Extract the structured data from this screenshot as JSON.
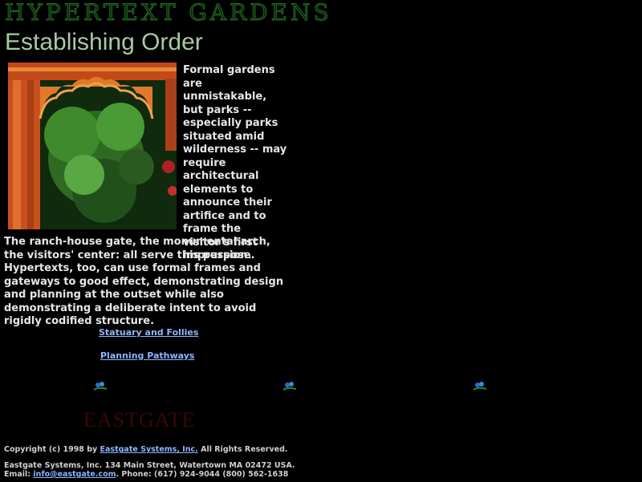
{
  "header": {
    "banner": "HYPERTEXT GARDENS",
    "title": "Establishing Order"
  },
  "content": {
    "side_paragraph": "Formal gardens are unmistakable, but parks -- especially parks situated amid wilderness -- may require architectural elements to announce their artifice and to frame the visitor's first impression.",
    "body_paragraph": "The ranch-house gate, the monumental arch, the visitors' center: all serve this purpose. Hypertexts, too, can use formal frames and gateways to good effect, demonstrating design and planning at the outset while also demonstrating a deliberate intent to avoid rigidly codified structure."
  },
  "nav": {
    "link1": "Statuary and Follies",
    "link2": "Planning Pathways"
  },
  "decor": {
    "flower_icon": "flower-icon",
    "logo": "EASTGATE"
  },
  "footer": {
    "copyright_prefix": "Copyright (c) 1998 by ",
    "company_link": "Eastgate Systems, Inc.",
    "copyright_suffix": " All Rights Reserved.",
    "address": "Eastgate Systems, Inc. 134 Main Street, Watertown MA 02472 USA.",
    "email_prefix": "Email: ",
    "email_link": "info@eastgate.com",
    "phone": ". Phone: (617) 924-9044 (800) 562-1638"
  },
  "colors": {
    "background": "#000000",
    "title": "#a9c9a2",
    "link": "#8fb4ff",
    "banner": "#1f6b1f",
    "logo": "#3a0707"
  }
}
